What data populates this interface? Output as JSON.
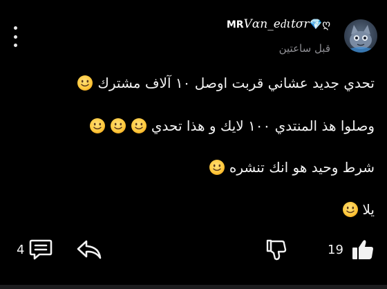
{
  "post": {
    "author": {
      "prefix": "MR",
      "name": "Vαn_eԁιtσr",
      "suffix": "💎ღ"
    },
    "timestamp": "قبل ساعتين",
    "lines": [
      "تحدي جديد عشاني قربت اوصل ١٠ آلاف مشترك",
      "وصلوا هذ المنتدي ١٠٠ لايك و هذا تحدي",
      "شرط وحيد هو انك تنشره",
      "يلا"
    ],
    "actions": {
      "comments_count": "4",
      "likes_count": "19"
    }
  },
  "icons": {
    "menu": "more-vertical-icon",
    "comment": "comment-icon",
    "share": "share-icon",
    "dislike": "thumbs-down-icon",
    "like": "thumbs-up-icon",
    "emoji": "slightly-smiling-face-icon"
  },
  "colors": {
    "background": "#000000",
    "text": "#f2f2f2",
    "muted": "#8e8e93",
    "emoji": "#ffc83d"
  }
}
